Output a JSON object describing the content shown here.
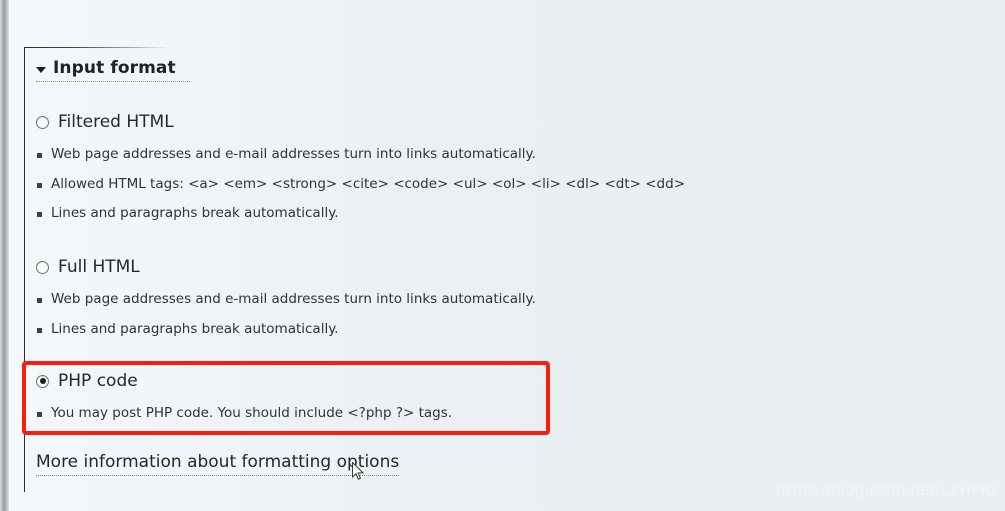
{
  "fieldset": {
    "legend": "Input format",
    "collapse_icon": "triangle-down-icon"
  },
  "formats": [
    {
      "id": "filtered-html",
      "label": "Filtered HTML",
      "selected": false,
      "tips": [
        "Web page addresses and e-mail addresses turn into links automatically.",
        "Allowed HTML tags: <a> <em> <strong> <cite> <code> <ul> <ol> <li> <dl> <dt> <dd>",
        "Lines and paragraphs break automatically."
      ]
    },
    {
      "id": "full-html",
      "label": "Full HTML",
      "selected": false,
      "tips": [
        "Web page addresses and e-mail addresses turn into links automatically.",
        "Lines and paragraphs break automatically."
      ]
    },
    {
      "id": "php-code",
      "label": "PHP code",
      "selected": true,
      "tips": [
        "You may post PHP code. You should include <?php ?> tags."
      ]
    }
  ],
  "more_info_link": "More information about formatting options",
  "highlight": {
    "target": "php-code",
    "color": "#fa1d0d"
  },
  "watermark": "https://blog.csdn.net/LZHPIG",
  "colors": {
    "page_background": "#e9eff2",
    "text": "#23282c",
    "highlight_red": "#fa1d0d",
    "border": "#2c2c2c"
  }
}
